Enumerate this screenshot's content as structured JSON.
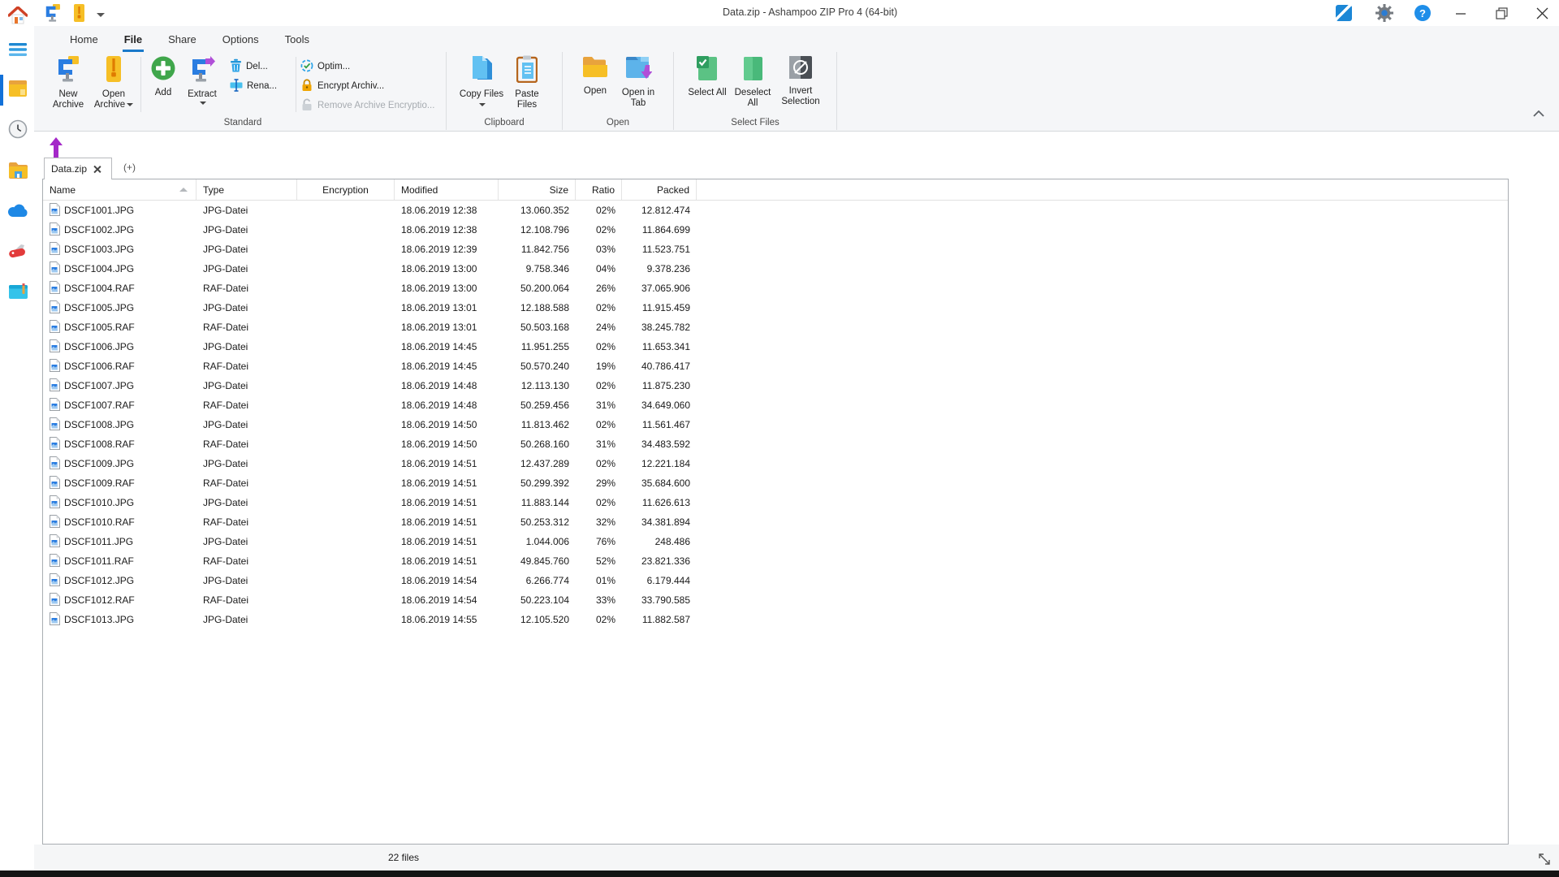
{
  "titlebar": {
    "title": "Data.zip - Ashampoo ZIP Pro 4 (64-bit)",
    "help_glyph": "?"
  },
  "ribbon": {
    "tabs": [
      "Home",
      "File",
      "Share",
      "Options",
      "Tools"
    ],
    "active_tab": "File",
    "groups": {
      "standard": "Standard",
      "clipboard": "Clipboard",
      "open": "Open",
      "select_files": "Select Files"
    },
    "buttons": {
      "new_archive": "New Archive",
      "open_archive": "Open Archive",
      "add": "Add",
      "extract": "Extract",
      "delete": "Del...",
      "rename": "Rena...",
      "optimize": "Optim...",
      "encrypt": "Encrypt Archiv...",
      "remove_encryption": "Remove Archive Encryptio...",
      "copy_files": "Copy Files",
      "paste_files": "Paste Files",
      "open": "Open",
      "open_in_tab": "Open in Tab",
      "select_all": "Select All",
      "deselect_all": "Deselect All",
      "invert_selection": "Invert Selection"
    }
  },
  "tabbar": {
    "active_tab": "Data.zip",
    "new_tab": "(+)"
  },
  "table": {
    "columns": [
      "Name",
      "Type",
      "Encryption",
      "Modified",
      "Size",
      "Ratio",
      "Packed"
    ],
    "rows": [
      {
        "name": "DSCF1001.JPG",
        "type": "JPG-Datei",
        "encryption": "",
        "modified": "18.06.2019 12:38",
        "size": "13.060.352",
        "ratio": "02%",
        "packed": "12.812.474"
      },
      {
        "name": "DSCF1002.JPG",
        "type": "JPG-Datei",
        "encryption": "",
        "modified": "18.06.2019 12:38",
        "size": "12.108.796",
        "ratio": "02%",
        "packed": "11.864.699"
      },
      {
        "name": "DSCF1003.JPG",
        "type": "JPG-Datei",
        "encryption": "",
        "modified": "18.06.2019 12:39",
        "size": "11.842.756",
        "ratio": "03%",
        "packed": "11.523.751"
      },
      {
        "name": "DSCF1004.JPG",
        "type": "JPG-Datei",
        "encryption": "",
        "modified": "18.06.2019 13:00",
        "size": "9.758.346",
        "ratio": "04%",
        "packed": "9.378.236"
      },
      {
        "name": "DSCF1004.RAF",
        "type": "RAF-Datei",
        "encryption": "",
        "modified": "18.06.2019 13:00",
        "size": "50.200.064",
        "ratio": "26%",
        "packed": "37.065.906"
      },
      {
        "name": "DSCF1005.JPG",
        "type": "JPG-Datei",
        "encryption": "",
        "modified": "18.06.2019 13:01",
        "size": "12.188.588",
        "ratio": "02%",
        "packed": "11.915.459"
      },
      {
        "name": "DSCF1005.RAF",
        "type": "RAF-Datei",
        "encryption": "",
        "modified": "18.06.2019 13:01",
        "size": "50.503.168",
        "ratio": "24%",
        "packed": "38.245.782"
      },
      {
        "name": "DSCF1006.JPG",
        "type": "JPG-Datei",
        "encryption": "",
        "modified": "18.06.2019 14:45",
        "size": "11.951.255",
        "ratio": "02%",
        "packed": "11.653.341"
      },
      {
        "name": "DSCF1006.RAF",
        "type": "RAF-Datei",
        "encryption": "",
        "modified": "18.06.2019 14:45",
        "size": "50.570.240",
        "ratio": "19%",
        "packed": "40.786.417"
      },
      {
        "name": "DSCF1007.JPG",
        "type": "JPG-Datei",
        "encryption": "",
        "modified": "18.06.2019 14:48",
        "size": "12.113.130",
        "ratio": "02%",
        "packed": "11.875.230"
      },
      {
        "name": "DSCF1007.RAF",
        "type": "RAF-Datei",
        "encryption": "",
        "modified": "18.06.2019 14:48",
        "size": "50.259.456",
        "ratio": "31%",
        "packed": "34.649.060"
      },
      {
        "name": "DSCF1008.JPG",
        "type": "JPG-Datei",
        "encryption": "",
        "modified": "18.06.2019 14:50",
        "size": "11.813.462",
        "ratio": "02%",
        "packed": "11.561.467"
      },
      {
        "name": "DSCF1008.RAF",
        "type": "RAF-Datei",
        "encryption": "",
        "modified": "18.06.2019 14:50",
        "size": "50.268.160",
        "ratio": "31%",
        "packed": "34.483.592"
      },
      {
        "name": "DSCF1009.JPG",
        "type": "JPG-Datei",
        "encryption": "",
        "modified": "18.06.2019 14:51",
        "size": "12.437.289",
        "ratio": "02%",
        "packed": "12.221.184"
      },
      {
        "name": "DSCF1009.RAF",
        "type": "RAF-Datei",
        "encryption": "",
        "modified": "18.06.2019 14:51",
        "size": "50.299.392",
        "ratio": "29%",
        "packed": "35.684.600"
      },
      {
        "name": "DSCF1010.JPG",
        "type": "JPG-Datei",
        "encryption": "",
        "modified": "18.06.2019 14:51",
        "size": "11.883.144",
        "ratio": "02%",
        "packed": "11.626.613"
      },
      {
        "name": "DSCF1010.RAF",
        "type": "RAF-Datei",
        "encryption": "",
        "modified": "18.06.2019 14:51",
        "size": "50.253.312",
        "ratio": "32%",
        "packed": "34.381.894"
      },
      {
        "name": "DSCF1011.JPG",
        "type": "JPG-Datei",
        "encryption": "",
        "modified": "18.06.2019 14:51",
        "size": "1.044.006",
        "ratio": "76%",
        "packed": "248.486"
      },
      {
        "name": "DSCF1011.RAF",
        "type": "RAF-Datei",
        "encryption": "",
        "modified": "18.06.2019 14:51",
        "size": "49.845.760",
        "ratio": "52%",
        "packed": "23.821.336"
      },
      {
        "name": "DSCF1012.JPG",
        "type": "JPG-Datei",
        "encryption": "",
        "modified": "18.06.2019 14:54",
        "size": "6.266.774",
        "ratio": "01%",
        "packed": "6.179.444"
      },
      {
        "name": "DSCF1012.RAF",
        "type": "RAF-Datei",
        "encryption": "",
        "modified": "18.06.2019 14:54",
        "size": "50.223.104",
        "ratio": "33%",
        "packed": "33.790.585"
      },
      {
        "name": "DSCF1013.JPG",
        "type": "JPG-Datei",
        "encryption": "",
        "modified": "18.06.2019 14:55",
        "size": "12.105.520",
        "ratio": "02%",
        "packed": "11.882.587"
      }
    ]
  },
  "statusbar": {
    "files_count": "22 files"
  },
  "colors": {
    "accent_blue": "#1979ca",
    "selection_bar": "#1271d9",
    "disabled_text": "#a6abb0"
  }
}
